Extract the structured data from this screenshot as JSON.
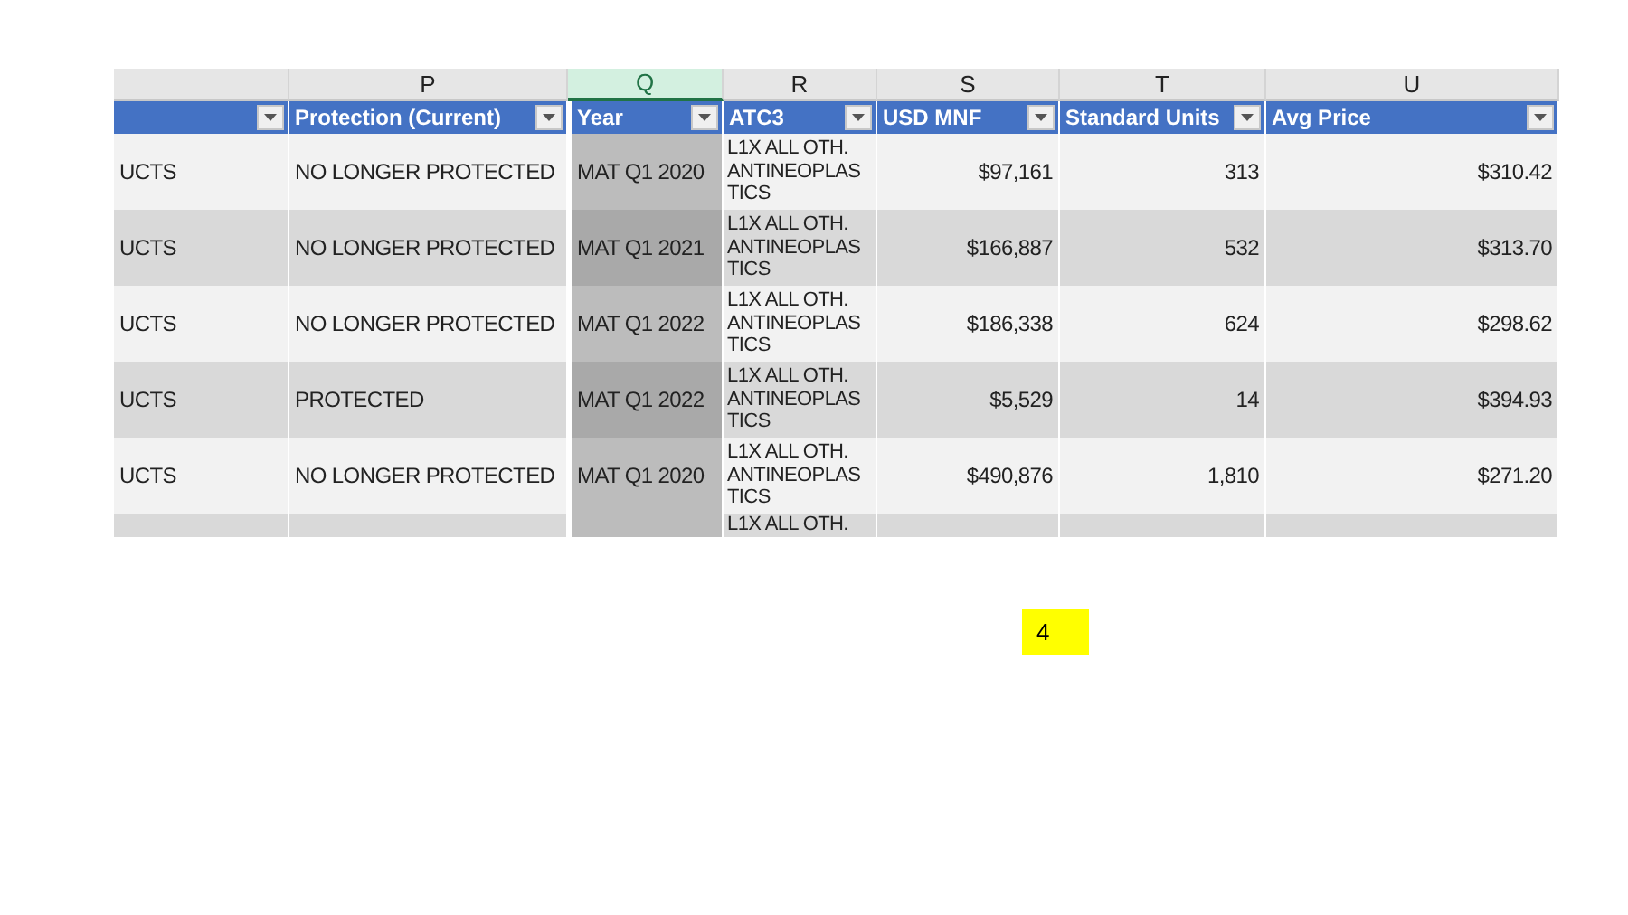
{
  "sheet": {
    "columns": [
      {
        "selected": false
      },
      {
        "letter": "P",
        "header": "Protection (Current)",
        "selected": false
      },
      {
        "letter": "Q",
        "header": "Year",
        "selected": true
      },
      {
        "letter": "R",
        "header": "ATC3",
        "selected": false
      },
      {
        "letter": "S",
        "header": "USD MNF",
        "selected": false
      },
      {
        "letter": "T",
        "header": "Standard Units",
        "selected": false
      },
      {
        "letter": "U",
        "header": "Avg Price",
        "selected": false
      }
    ],
    "rows": [
      [
        "UCTS",
        "NO LONGER PROTECTED",
        "MAT Q1 2020",
        "L1X ALL OTH. ANTINEOPLASTICS",
        "$97,161",
        "313",
        "$310.42"
      ],
      [
        "UCTS",
        "NO LONGER PROTECTED",
        "MAT Q1 2021",
        "L1X ALL OTH. ANTINEOPLASTICS",
        "$166,887",
        "532",
        "$313.70"
      ],
      [
        "UCTS",
        "NO LONGER PROTECTED",
        "MAT Q1 2022",
        "L1X ALL OTH. ANTINEOPLASTICS",
        "$186,338",
        "624",
        "$298.62"
      ],
      [
        "UCTS",
        "PROTECTED",
        "MAT Q1 2022",
        "L1X ALL OTH. ANTINEOPLASTICS",
        "$5,529",
        "14",
        "$394.93"
      ],
      [
        "UCTS",
        "NO LONGER PROTECTED",
        "MAT Q1 2020",
        "L1X ALL OTH. ANTINEOPLASTICS",
        "$490,876",
        "1,810",
        "$271.20"
      ]
    ],
    "partial_row": {
      "atc3": "L1X ALL OTH."
    }
  },
  "note_label": "4"
}
